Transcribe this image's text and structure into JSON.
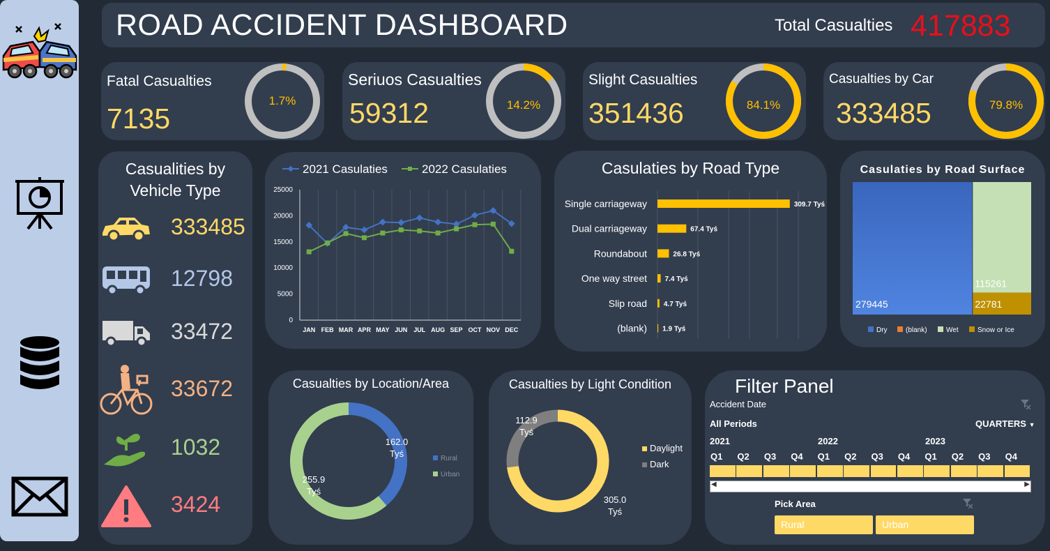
{
  "header": {
    "title": "ROAD ACCIDENT DASHBOARD",
    "total_label": "Total Casualties",
    "total_value": "417883"
  },
  "sidebar": {
    "icons": [
      "car-crash-icon",
      "presentation-chart-icon",
      "database-icon",
      "mail-icon"
    ]
  },
  "kpis": [
    {
      "label": "Fatal Casualties",
      "value": "7135",
      "pct_label": "1.7%",
      "pct": 0.017
    },
    {
      "label": "Seriuos Casualties",
      "value": "59312",
      "pct_label": "14.2%",
      "pct": 0.142
    },
    {
      "label": "Slight Casualties",
      "value": "351436",
      "pct_label": "84.1%",
      "pct": 0.841
    },
    {
      "label": "Casualties by Car",
      "value": "333485",
      "pct_label": "79.8%",
      "pct": 0.798
    }
  ],
  "vehicle": {
    "title_line1": "Casualities by",
    "title_line2": "Vehicle Type",
    "rows": [
      {
        "icon": "car-icon",
        "value": "333485",
        "color": "#ffd966"
      },
      {
        "icon": "bus-icon",
        "value": "12798",
        "color": "#b4c7e7"
      },
      {
        "icon": "truck-icon",
        "value": "33472",
        "color": "#d9d9d9"
      },
      {
        "icon": "bicycle-icon",
        "value": "33672",
        "color": "#f4b183"
      },
      {
        "icon": "plant-hand-icon",
        "value": "1032",
        "color": "#a9d18e"
      },
      {
        "icon": "warning-icon",
        "value": "3424",
        "color": "#ff7c80"
      }
    ]
  },
  "chart_data": [
    {
      "type": "line",
      "categories": [
        "JAN",
        "FEB",
        "MAR",
        "APR",
        "MAY",
        "JUN",
        "JUL",
        "AUG",
        "SEP",
        "OCT",
        "NOV",
        "DEC"
      ],
      "series": [
        {
          "name": "2021 Casulaties",
          "color": "#4472c4",
          "values": [
            18200,
            14700,
            17800,
            17300,
            18800,
            18700,
            19600,
            18800,
            18400,
            20100,
            21000,
            18500
          ]
        },
        {
          "name": "2022 Casulaties",
          "color": "#70ad47",
          "values": [
            13100,
            14800,
            16600,
            15800,
            16700,
            17300,
            17100,
            16700,
            17500,
            18300,
            18400,
            13200
          ]
        }
      ],
      "ylim": [
        0,
        25000
      ],
      "yticks": [
        "0",
        "5000",
        "10000",
        "15000",
        "20000",
        "25000"
      ],
      "grid": true,
      "legend": "top"
    },
    {
      "type": "bar",
      "title": "Casulaties by Road Type",
      "categories": [
        "Single carriageway",
        "Dual carriageway",
        "Roundabout",
        "One way street",
        "Slip road",
        "(blank)"
      ],
      "values": [
        309.7,
        67.4,
        26.8,
        7.4,
        4.7,
        1.9
      ],
      "labels": [
        "309.7 Tyś",
        "67.4 Tyś",
        "26.8 Tyś",
        "7.4 Tyś",
        "4.7 Tyś",
        "1.9 Tyś"
      ],
      "color": "#ffc000",
      "unit": "Tyś"
    },
    {
      "type": "area",
      "title": "Casulaties by Road Surface",
      "series": [
        {
          "name": "Dry",
          "value": 279445,
          "color": "#4472c4"
        },
        {
          "name": "(blank)",
          "value": 0,
          "color": "#ed7d31"
        },
        {
          "name": "Wet",
          "value": 115261,
          "color": "#c5e0b4"
        },
        {
          "name": "Snow or Ice",
          "value": 22781,
          "color": "#bf9000"
        }
      ],
      "legend": "bottom"
    },
    {
      "type": "pie",
      "title": "Casualties by Location/Area",
      "series": [
        {
          "name": "Rural",
          "value": 162.0,
          "label": "162.0 Tyś",
          "color": "#4472c4"
        },
        {
          "name": "Urban",
          "value": 255.9,
          "label": "255.9 Tyś",
          "color": "#a9d18e"
        }
      ],
      "legend": "right"
    },
    {
      "type": "pie",
      "title": "Casualties by Light Condition",
      "series": [
        {
          "name": "Daylight",
          "value": 305.0,
          "label": "305.0 Tyś",
          "color": "#ffd966"
        },
        {
          "name": "Dark",
          "value": 112.9,
          "label": "112.9 Tyś",
          "color": "#7f7f7f"
        }
      ],
      "legend": "right"
    }
  ],
  "filter": {
    "title": "Filter Panel",
    "date_label": "Accident Date",
    "period_label": "All Periods",
    "level_label": "QUARTERS",
    "years": [
      "2021",
      "2022",
      "2023"
    ],
    "quarters": [
      "Q1",
      "Q2",
      "Q3",
      "Q4",
      "Q1",
      "Q2",
      "Q3",
      "Q4",
      "Q1",
      "Q2",
      "Q3",
      "Q4"
    ],
    "area_label": "Pick Area",
    "areas": [
      "Rural",
      "Urban"
    ]
  }
}
